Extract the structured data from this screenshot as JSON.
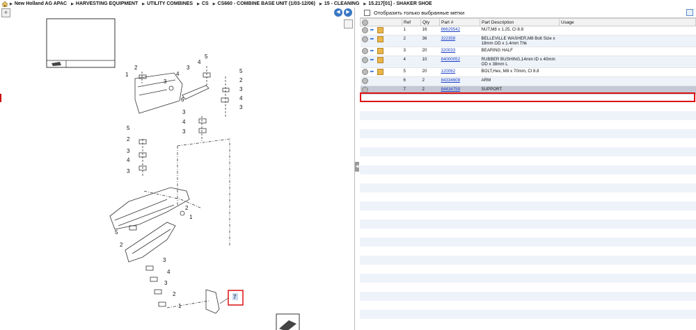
{
  "breadcrumb": {
    "items": [
      "New Holland AG APAC",
      "HARVESTING EQUIPMENT",
      "UTILITY COMBINES",
      "CS",
      "CS660 - COMBINE BASE UNIT (1/03-12/06)",
      "15 - CLEANING",
      "15.217[01] - SHAKER SHOE"
    ]
  },
  "filter": {
    "label": "Отобразить только выбранные метки"
  },
  "table": {
    "headers": [
      "",
      "Ref",
      "Qty",
      "Part #",
      "Part Description",
      "Usage"
    ],
    "rows": [
      {
        "ref": "1",
        "qty": "16",
        "part": "86629542",
        "desc": "NUT,M8 x 1.25, Cl 8.8",
        "usage": "",
        "icons": true
      },
      {
        "ref": "2",
        "qty": "36",
        "part": "322358",
        "desc": "BELLEVILLE WASHER,M8 Bolt Size x 18mm OD x 1.4mm Thk",
        "usage": "",
        "icons": true
      },
      {
        "ref": "3",
        "qty": "20",
        "part": "320033",
        "desc": "BEARING HALF",
        "usage": "",
        "icons": true
      },
      {
        "ref": "4",
        "qty": "10",
        "part": "84000052",
        "desc": "RUBBER BUSHING,14mm ID x 40mm OD x 38mm L",
        "usage": "",
        "icons": true
      },
      {
        "ref": "5",
        "qty": "20",
        "part": "120062",
        "desc": "BOLT,Hex, M8 x 70mm, Cl 8.8",
        "usage": "",
        "icons": true
      },
      {
        "ref": "6",
        "qty": "2",
        "part": "84334608",
        "desc": "ARM",
        "usage": "",
        "icons": false
      },
      {
        "ref": "7",
        "qty": "2",
        "part": "84434759",
        "desc": "SUPPORT",
        "usage": "",
        "icons": false
      }
    ]
  },
  "diagram": {
    "callouts": [
      "1",
      "2",
      "3",
      "4",
      "5",
      "6",
      "7"
    ],
    "highlighted_callout": "7"
  },
  "colors": {
    "selection": "#d11111",
    "link": "#1a3ec8",
    "nav_button": "#3a78c4"
  }
}
